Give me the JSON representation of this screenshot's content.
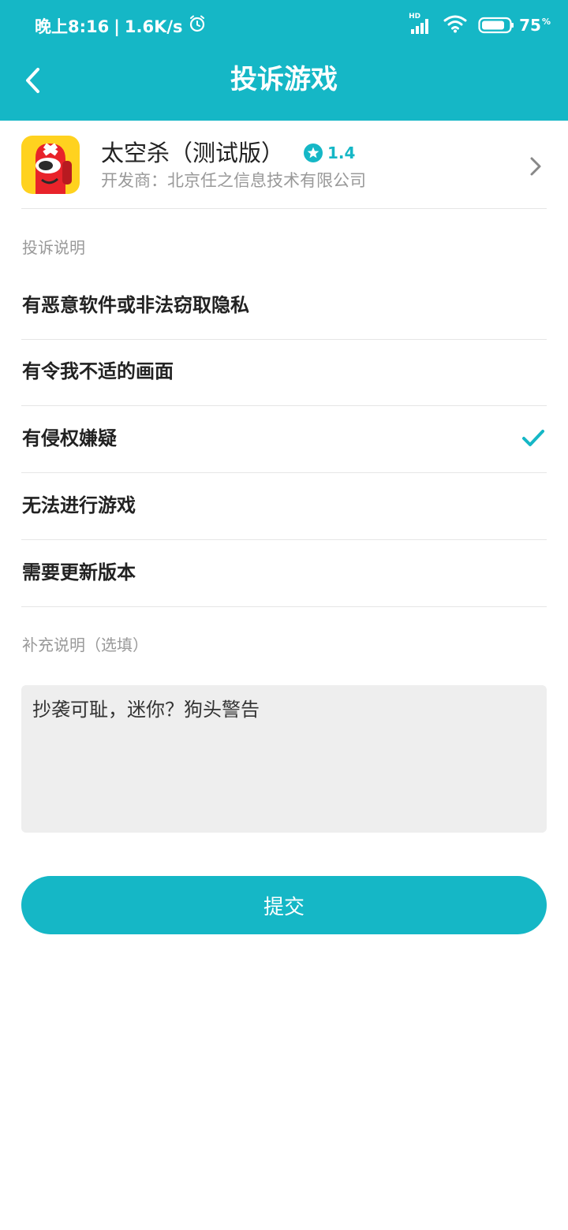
{
  "status_bar": {
    "time": "晚上8:16",
    "separator": "|",
    "speed": "1.6K/s",
    "network": "HD",
    "battery": "75",
    "battery_unit": "%"
  },
  "header": {
    "title": "投诉游戏"
  },
  "game": {
    "name": "太空杀（测试版）",
    "rating": "1.4",
    "developer": "开发商：北京任之信息技术有限公司"
  },
  "complaint": {
    "section_label": "投诉说明",
    "options": [
      {
        "label": "有恶意软件或非法窃取隐私",
        "selected": false
      },
      {
        "label": "有令我不适的画面",
        "selected": false
      },
      {
        "label": "有侵权嫌疑",
        "selected": true
      },
      {
        "label": "无法进行游戏",
        "selected": false
      },
      {
        "label": "需要更新版本",
        "selected": false
      }
    ]
  },
  "supplement": {
    "section_label": "补充说明（选填）",
    "value": "抄袭可耻，迷你？狗头警告"
  },
  "submit_label": "提交",
  "colors": {
    "accent": "#15b7c6",
    "text": "#222222",
    "muted": "#999999",
    "input_bg": "#eeeeee"
  }
}
